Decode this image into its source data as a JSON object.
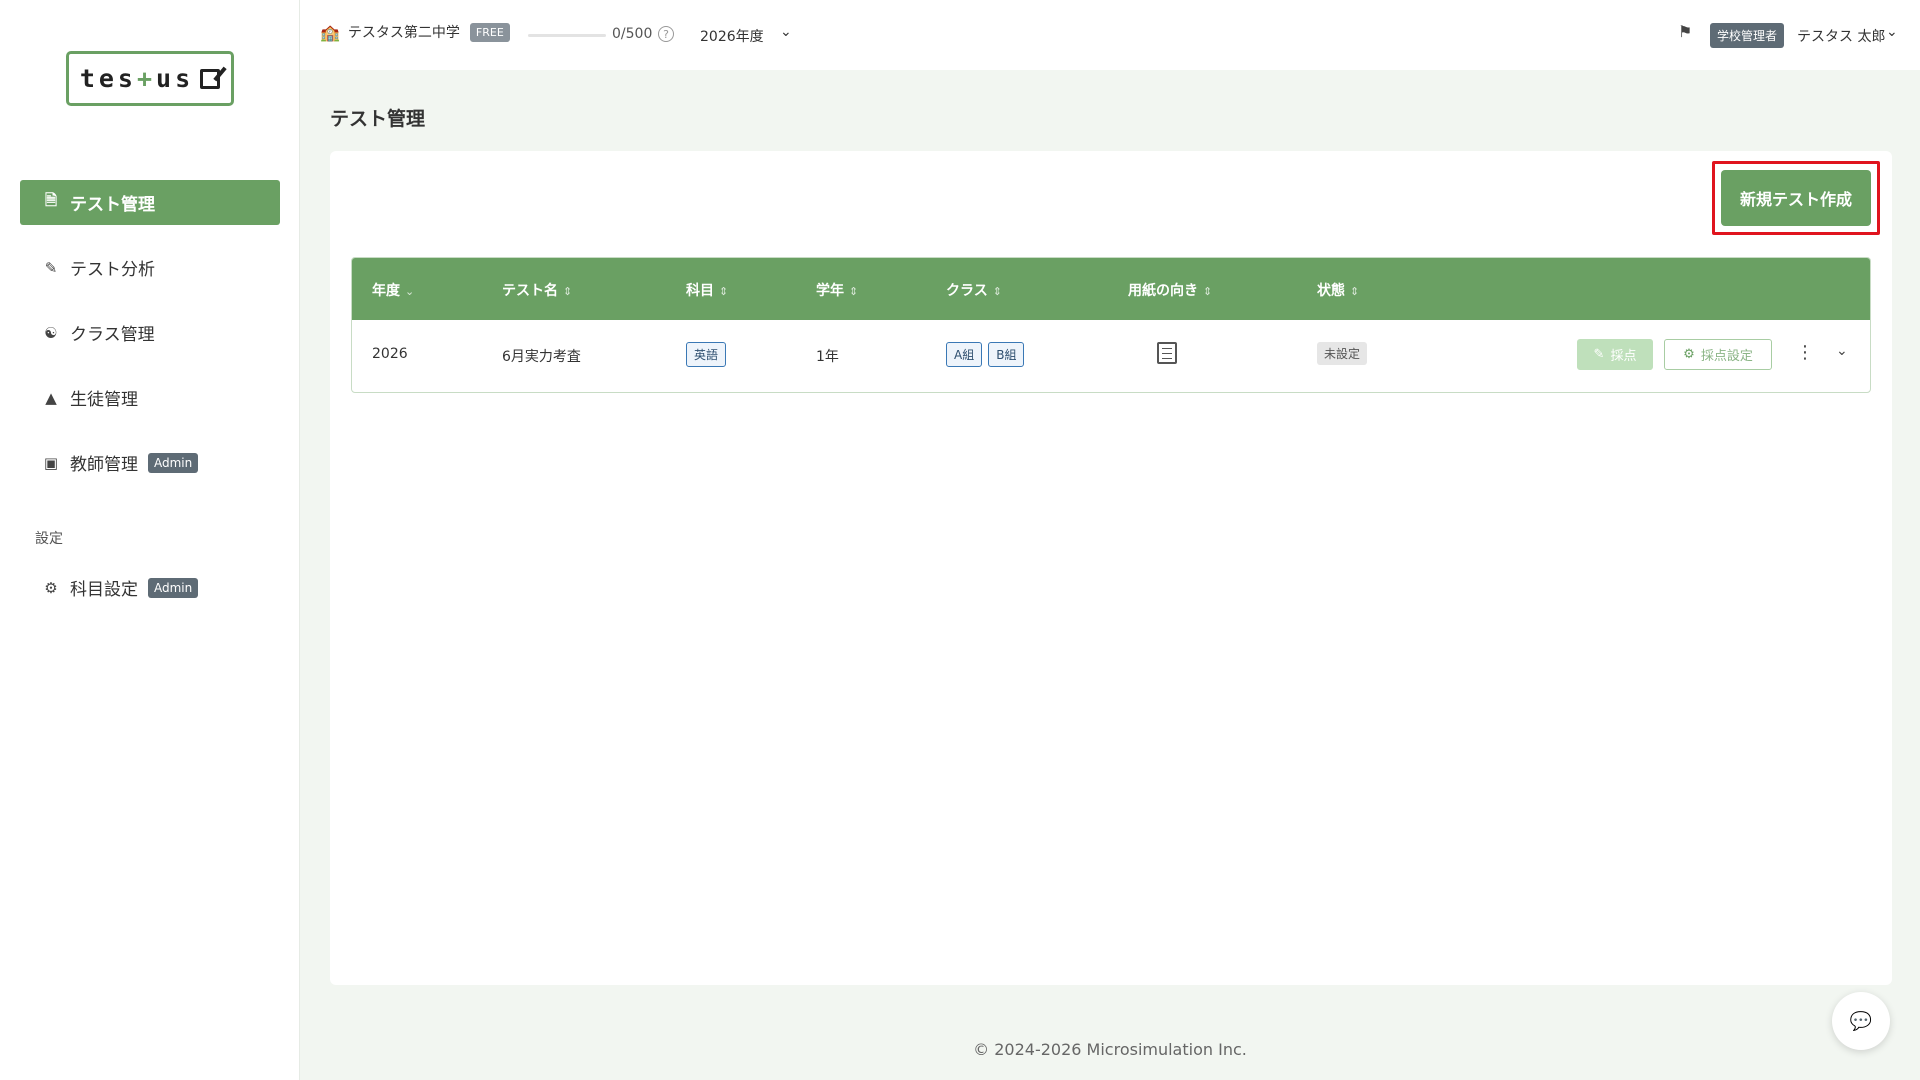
{
  "sidebar": {
    "logo": {
      "text": "tes",
      "plus": "+",
      "text2": "us"
    },
    "items": [
      {
        "label": "テスト管理",
        "icon": "document-icon",
        "active": true
      },
      {
        "label": "テスト分析",
        "icon": "analysis-icon"
      },
      {
        "label": "クラス管理",
        "icon": "group-icon"
      },
      {
        "label": "生徒管理",
        "icon": "student-icon"
      },
      {
        "label": "教師管理",
        "icon": "teacher-icon",
        "badge": "Admin"
      }
    ],
    "section_label": "設定",
    "settings_items": [
      {
        "label": "科目設定",
        "icon": "gear-icon",
        "badge": "Admin"
      }
    ]
  },
  "topbar": {
    "school_name": "テスタス第二中学",
    "plan_badge": "FREE",
    "usage": "0/500",
    "usage_fraction": 0,
    "help": "?",
    "year": "2026年度",
    "role_badge": "学校管理者",
    "user_name": "テスタス 太郎"
  },
  "main": {
    "title": "テスト管理",
    "new_test_button": "新規テスト作成",
    "table": {
      "columns": [
        "年度",
        "テスト名",
        "科目",
        "学年",
        "クラス",
        "用紙の向き",
        "状態"
      ],
      "rows": [
        {
          "year": "2026",
          "name": "6月実力考査",
          "subject": "英語",
          "grade": "1年",
          "classes": [
            "A組",
            "B組"
          ],
          "status": "未設定",
          "grade_button": "採点",
          "grade_settings_button": "採点設定"
        }
      ]
    }
  },
  "footer": "© 2024-2026 Microsimulation Inc.",
  "colors": {
    "accent": "#6aa063",
    "highlight": "#e0141e",
    "badge": "#5e6b75"
  }
}
